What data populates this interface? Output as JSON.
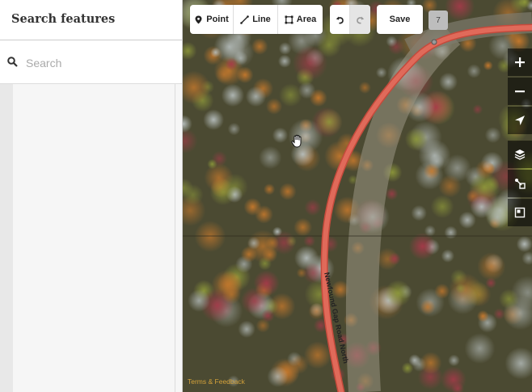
{
  "sidebar": {
    "title": "Search features",
    "search": {
      "placeholder": "Search",
      "value": "",
      "icon": "search-icon"
    }
  },
  "toolbar": {
    "modes": [
      {
        "label": "Point",
        "icon": "point-icon"
      },
      {
        "label": "Line",
        "icon": "line-icon"
      },
      {
        "label": "Area",
        "icon": "area-icon"
      }
    ],
    "undo_icon": "undo-icon",
    "redo_icon": "redo-icon",
    "save_label": "Save",
    "edit_count": "7"
  },
  "map_controls": [
    "zoom-in-icon",
    "zoom-out-icon",
    "locate-icon",
    "layers-icon",
    "map-data-icon",
    "issues-icon"
  ],
  "map": {
    "road_label": "Newfound Gap Road North",
    "attribution": "Terms & Feedback",
    "road_color": "#e06a5a"
  }
}
